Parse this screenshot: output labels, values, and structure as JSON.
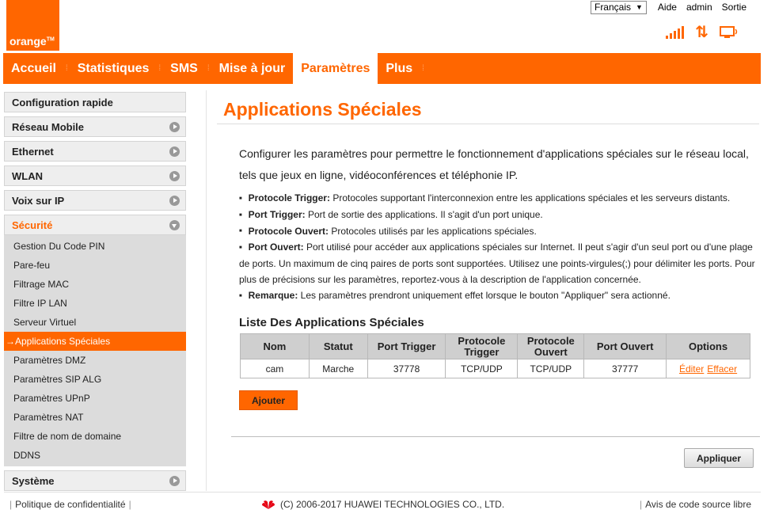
{
  "brand": {
    "logo_text": "orange",
    "logo_tm": "TM",
    "accent": "#ff6600"
  },
  "topbar": {
    "language": "Français",
    "links": [
      "Aide",
      "admin",
      "Sortie"
    ]
  },
  "status_icons": [
    "signal-strength-icon",
    "data-transfer-icon",
    "connected-device-icon"
  ],
  "nav": {
    "items": [
      "Accueil",
      "Statistiques",
      "SMS",
      "Mise à jour",
      "Paramètres",
      "Plus"
    ],
    "active": "Paramètres"
  },
  "sidebar": {
    "items": [
      {
        "label": "Configuration rapide"
      },
      {
        "label": "Réseau Mobile"
      },
      {
        "label": "Ethernet"
      },
      {
        "label": "WLAN"
      },
      {
        "label": "Voix sur IP"
      },
      {
        "label": "Sécurité"
      },
      {
        "label": "Système"
      }
    ],
    "security_subitems": [
      "Gestion Du Code PIN",
      "Pare-feu",
      "Filtrage MAC",
      "Filtre IP LAN",
      "Serveur Virtuel",
      "→Applications Spéciales",
      "Paramètres DMZ",
      "Paramètres SIP ALG",
      "Paramètres UPnP",
      "Paramètres NAT",
      "Filtre de nom de domaine",
      "DDNS"
    ]
  },
  "main": {
    "title": "Applications Spéciales",
    "intro": "Configurer les paramètres pour permettre le fonctionnement d'applications spéciales sur le réseau local, tels que jeux en ligne, vidéoconférences et téléphonie IP.",
    "bullets": [
      {
        "term": "Protocole Trigger:",
        "text": " Protocoles supportant l'interconnexion entre les applications spéciales et les serveurs distants."
      },
      {
        "term": "Port Trigger:",
        "text": " Port de sortie des applications. Il s'agit d'un port unique."
      },
      {
        "term": "Protocole Ouvert:",
        "text": " Protocoles utilisés par les applications spéciales."
      },
      {
        "term": "Port Ouvert:",
        "text": " Port utilisé pour accéder aux applications spéciales sur Internet. Il peut s'agir d'un seul port ou d'une plage de ports. Un maximum de cinq paires de ports sont supportées. Utilisez une points-virgules(;) pour délimiter les ports. Pour plus de précisions sur les paramètres, reportez-vous à la description de l'application concernée."
      },
      {
        "term": "Remarque:",
        "text": " Les paramètres prendront uniquement effet lorsque le bouton \"Appliquer\" sera actionné."
      }
    ],
    "list_title": "Liste Des Applications Spéciales",
    "table": {
      "headers": [
        "Nom",
        "Statut",
        "Port Trigger",
        "Protocole Trigger",
        "Protocole Ouvert",
        "Port Ouvert",
        "Options"
      ],
      "rows": [
        {
          "nom": "cam",
          "statut": "Marche",
          "port_trigger": "37778",
          "proto_trigger": "TCP/UDP",
          "proto_ouvert": "TCP/UDP",
          "port_ouvert": "37777",
          "edit": "Éditer",
          "delete": "Effacer"
        }
      ]
    },
    "add_button": "Ajouter",
    "apply_button": "Appliquer"
  },
  "footer": {
    "privacy": "Politique de confidentialité",
    "copyright": "(C) 2006-2017 HUAWEI TECHNOLOGIES CO., LTD.",
    "source": "Avis de code source libre"
  }
}
